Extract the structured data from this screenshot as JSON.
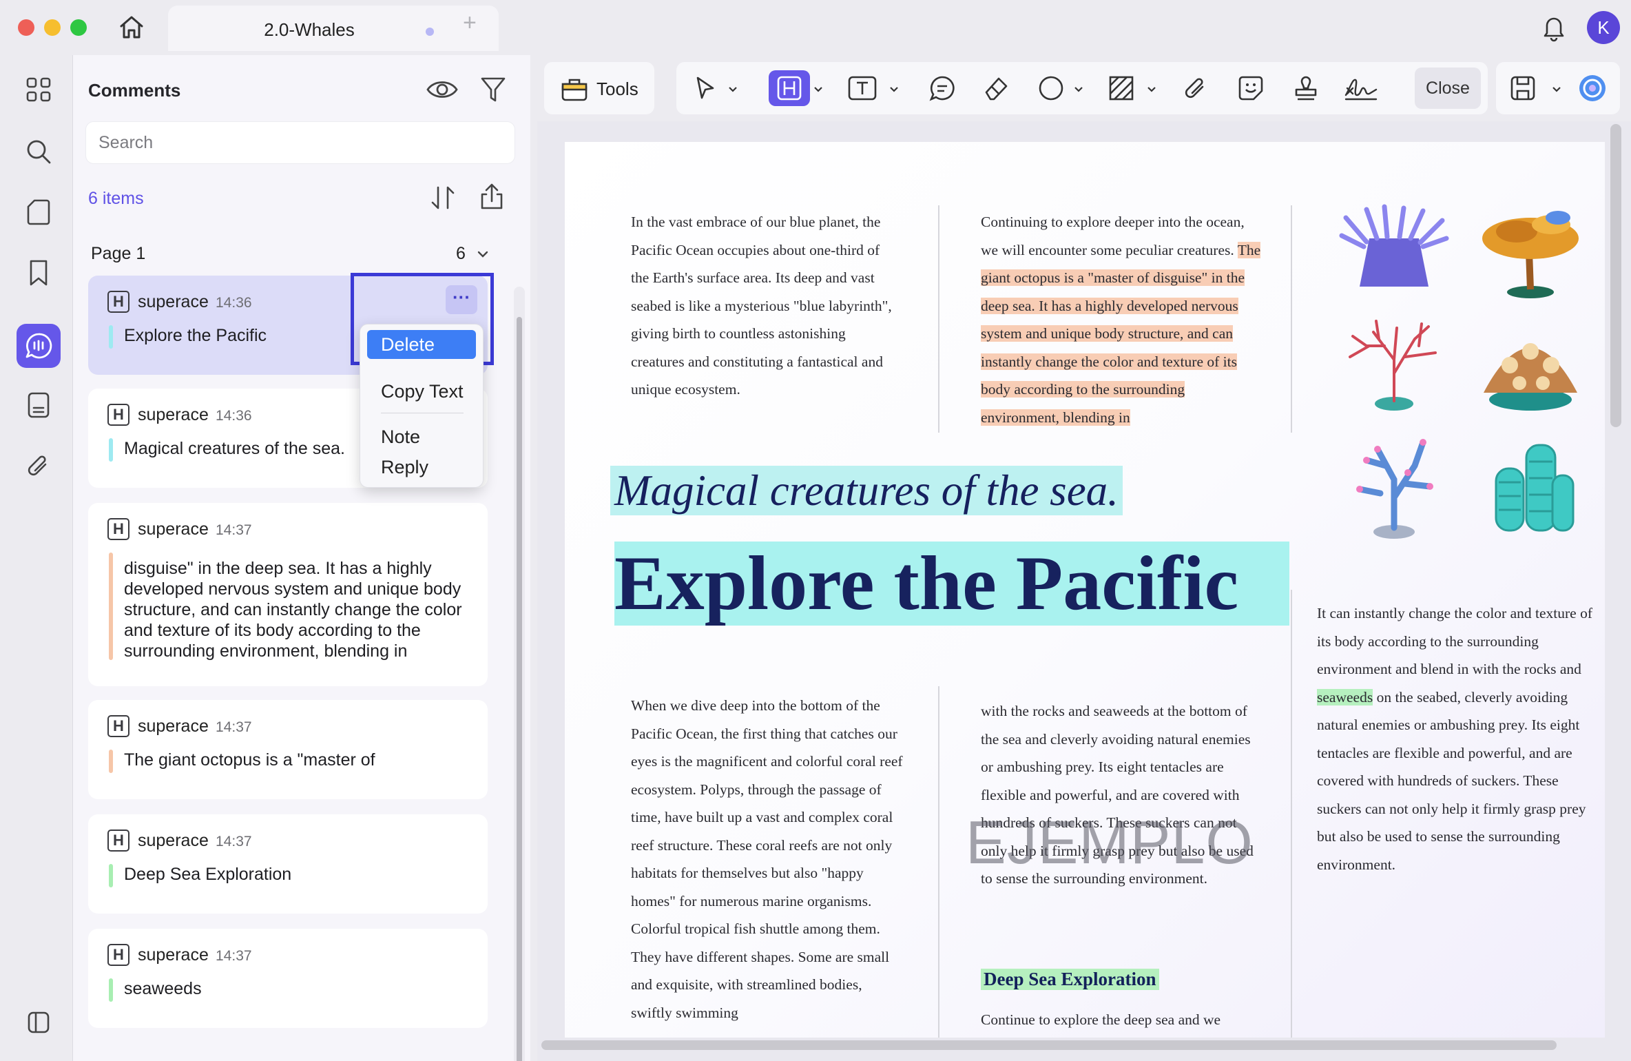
{
  "window": {
    "tab_title": "2.0-Whales",
    "new_tab": "+",
    "avatar_letter": "K"
  },
  "rail": {
    "items": [
      "grid-icon",
      "search-icon",
      "page-icon",
      "bookmark-icon",
      "comment-icon",
      "document-icon",
      "attachment-icon",
      "sidebar-toggle-icon"
    ],
    "active": "comment-icon"
  },
  "comments": {
    "title": "Comments",
    "search_placeholder": "Search",
    "items_count": "6 items",
    "page_label": "Page 1",
    "page_count": "6",
    "cards": [
      {
        "user": "superace",
        "time": "14:36",
        "text": "Explore the Pacific",
        "bar_color": "#9eeaf1"
      },
      {
        "user": "superace",
        "time": "14:36",
        "text": "Magical creatures of the sea.",
        "bar_color": "#9eeaf1"
      },
      {
        "user": "superace",
        "time": "14:37",
        "text": "disguise\" in the deep sea. It has a highly developed nervous system and unique body structure, and can instantly change the color and texture of its body according to the surrounding environment, blending in",
        "bar_color": "#f6c6a8"
      },
      {
        "user": "superace",
        "time": "14:37",
        "text": "The giant octopus is a \"master of",
        "bar_color": "#f6c6a8"
      },
      {
        "user": "superace",
        "time": "14:37",
        "text": "Deep Sea Exploration",
        "bar_color": "#a8eeb2"
      },
      {
        "user": "superace",
        "time": "14:37",
        "text": "seaweeds",
        "bar_color": "#a8eeb2"
      }
    ],
    "more_button": "···"
  },
  "context_menu": {
    "delete": "Delete",
    "copy_text": "Copy Text",
    "note": "Note",
    "reply": "Reply"
  },
  "toolbar": {
    "tools_label": "Tools",
    "close_label": "Close",
    "accent": "#6557e9"
  },
  "document": {
    "col1_top": "In the vast embrace of our blue planet, the Pacific Ocean occupies about one-third of the Earth's surface area. Its deep and vast seabed is like a mysterious \"blue labyrinth\", giving birth to countless astonishing creatures and constituting a fantastical and unique ecosystem.",
    "col2_top_plain": "Continuing to explore deeper into the ocean, we will encounter some peculiar creatures.",
    "col2_top_hl": "The giant octopus is a \"master of disguise\" in the deep sea. It has a highly developed nervous system and unique body structure, and can instantly change the color and texture of its body according to the surrounding environment, blending in",
    "subtitle": "Magical creatures of the sea.",
    "title": "Explore the Pacific",
    "col1_bottom": "When we dive deep into the bottom of the Pacific Ocean, the first thing that catches our eyes is the magnificent and colorful coral reef ecosystem. Polyps, through the passage of time, have built up a vast and complex coral reef structure. These coral reefs are not only habitats for themselves but also \"happy homes\" for numerous marine organisms. Colorful tropical fish shuttle among them. They have different shapes. Some are small and exquisite, with streamlined bodies, swiftly swimming",
    "col2_bottom": "with the rocks and seaweeds at the bottom of the sea and cleverly avoiding natural enemies or ambushing prey. Its eight tentacles are flexible and powerful, and are covered with hundreds of suckers. These suckers can not only help it firmly grasp prey but also be used to sense the surrounding environment.",
    "section_title": "Deep Sea Exploration",
    "col2_section": "Continue to explore the deep sea and we",
    "col3_before": "It can instantly change the color and texture of its body according to the surrounding environment and blend in with the rocks and",
    "col3_hl": "seaweeds",
    "col3_after": "on the seabed, cleverly avoiding natural enemies or ambushing prey. Its eight tentacles are flexible and powerful, and are covered with hundreds of suckers. These suckers can not only help it firmly grasp prey but also be used to sense the surrounding environment.",
    "watermark": "EJEMPLO"
  }
}
